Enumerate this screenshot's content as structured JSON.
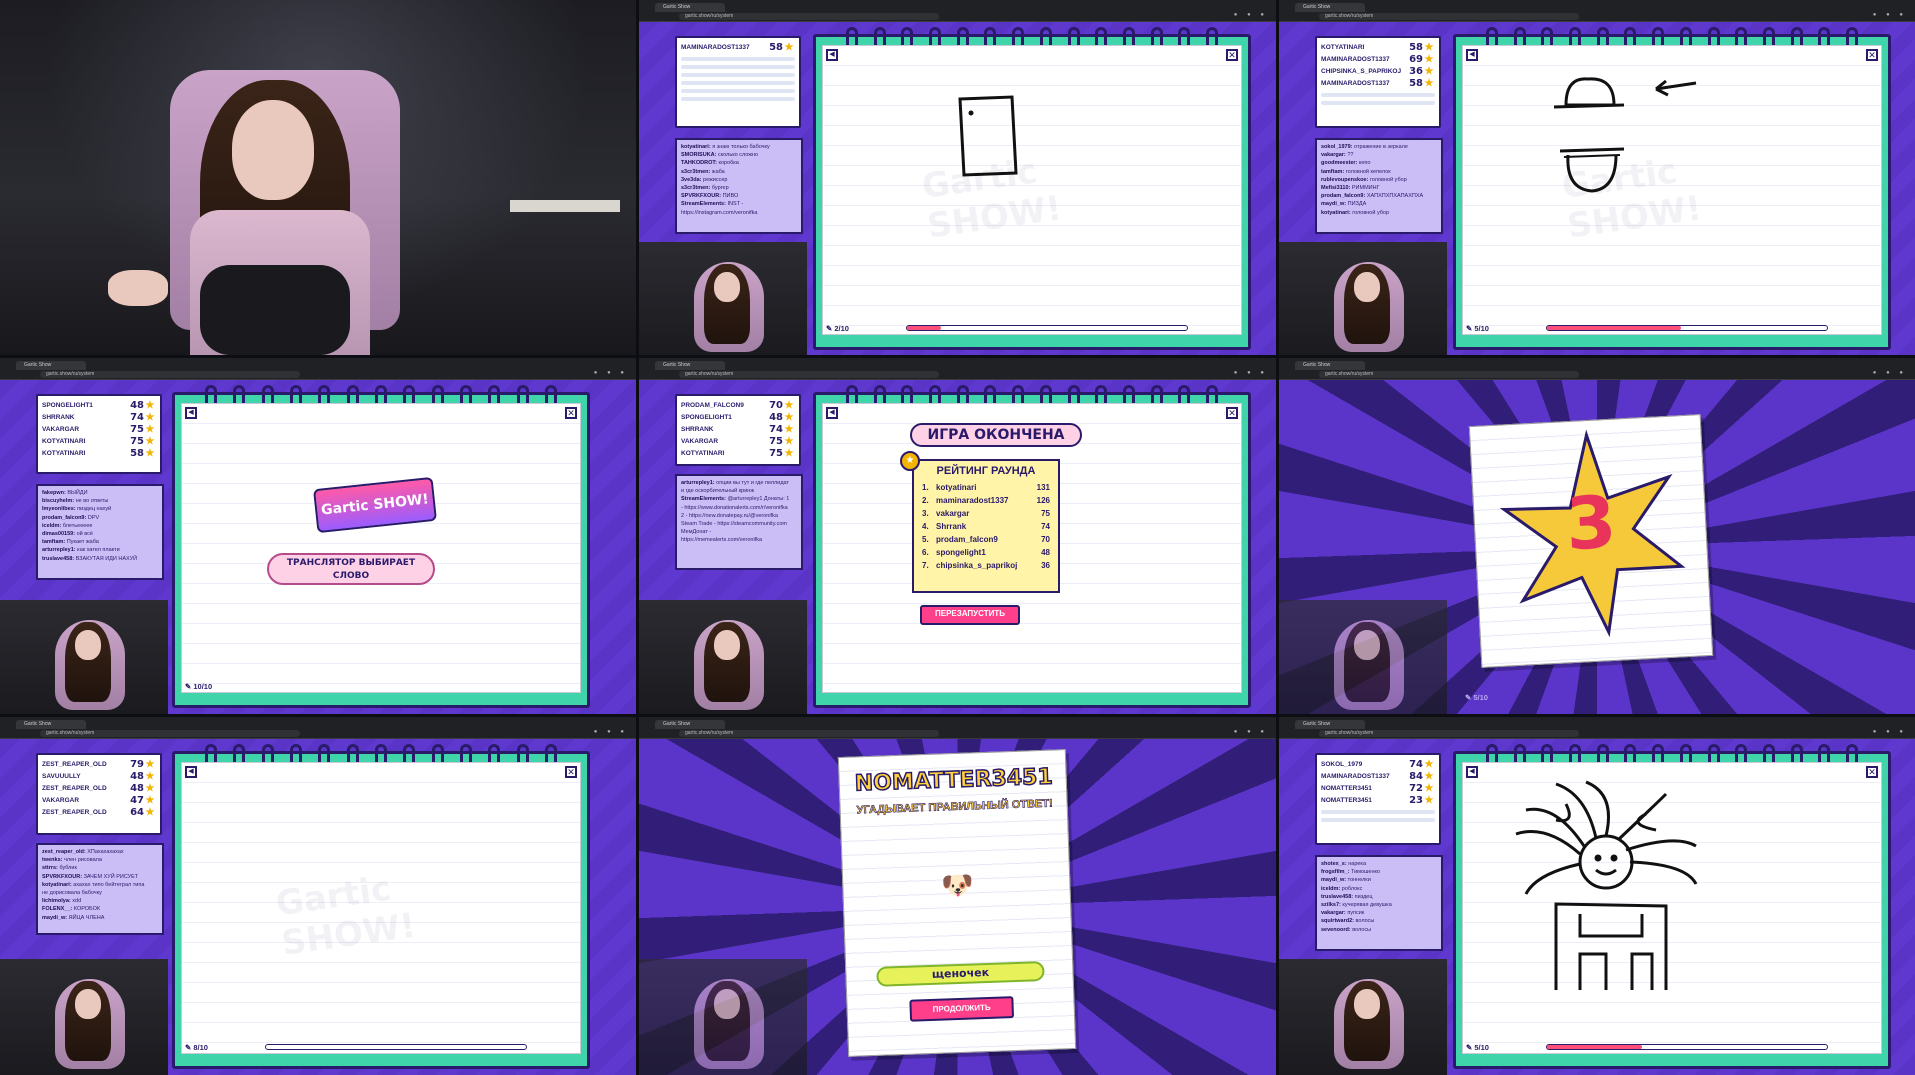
{
  "browser": {
    "tab_title": "Gartic Show",
    "url": "gartic.show/ru/system"
  },
  "icons": {
    "close": "close-icon",
    "volume": "volume-icon",
    "star": "star-icon",
    "pencil": "pencil-icon",
    "timer": "timer-icon"
  },
  "colors": {
    "game_bg": "#5b35c9",
    "board": "#3fd4a9",
    "ink": "#2a1a6a",
    "accent_pink": "#ff3f8a",
    "star": "#f2b400"
  },
  "tiles": {
    "t2": {
      "scores": [
        {
          "name": "MAMINARADOST1337",
          "points": "58"
        }
      ],
      "chat": [
        {
          "user": "kotyatinari:",
          "msg": "я знаю только бабочку"
        },
        {
          "user": "SMORISUKA:",
          "msg": "сколько сложно"
        },
        {
          "user": "TAHKODROT:",
          "msg": "коробка"
        },
        {
          "user": "s3cr3tmen:",
          "msg": "жаба"
        },
        {
          "user": "3ve3da:",
          "msg": "режиссер"
        },
        {
          "user": "s3cr3tmen:",
          "msg": "бургер"
        },
        {
          "user": "SPVRKFXOUR:",
          "msg": "ПИВО"
        },
        {
          "user": "StreamElements:",
          "msg": "INST -"
        },
        {
          "user": "",
          "msg": "https://instagram.com/veronifka"
        }
      ],
      "round": "2/10"
    },
    "t3": {
      "scores": [
        {
          "name": "KOTYATINARI",
          "points": "58"
        },
        {
          "name": "MAMINARADOST1337",
          "points": "69"
        },
        {
          "name": "CHIPSINKA_S_PAPRIKOJ",
          "points": "36"
        },
        {
          "name": "MAMINARADOST1337",
          "points": "58"
        }
      ],
      "chat": [
        {
          "user": "sokol_1979:",
          "msg": "отражение в зеркале"
        },
        {
          "user": "vakargar:",
          "msg": "??"
        },
        {
          "user": "goodmeester:",
          "msg": "кепо"
        },
        {
          "user": "tamftam:",
          "msg": "головной кепелок"
        },
        {
          "user": "rublevoupenskoe:",
          "msg": "головной убор"
        },
        {
          "user": "Mefisi3110:",
          "msg": "РИММИНГ"
        },
        {
          "user": "prodam_falcon9:",
          "msg": "ХАПХПХПХАПАХПХА"
        },
        {
          "user": "maydi_w:",
          "msg": "ПИЗДА"
        },
        {
          "user": "kotyatinari:",
          "msg": "головной убор"
        }
      ],
      "round": "5/10"
    },
    "t4": {
      "scores": [
        {
          "name": "SPONGELIGHT1",
          "points": "48"
        },
        {
          "name": "SHRRANK",
          "points": "74"
        },
        {
          "name": "VAKARGAR",
          "points": "75"
        },
        {
          "name": "KOTYATINARI",
          "points": "75"
        },
        {
          "name": "KOTYATINARI",
          "points": "58"
        }
      ],
      "chat": [
        {
          "user": "fakepwn:",
          "msg": "ВЫЙДИ"
        },
        {
          "user": "biscuyhelm:",
          "msg": "не во ответы"
        },
        {
          "user": "Imyeonlibes:",
          "msg": "пиздец нахуй"
        },
        {
          "user": "prodam_falcon9:",
          "msg": "DPV"
        },
        {
          "user": "iceldm:",
          "msg": "блетьеееее"
        },
        {
          "user": "dimas00159:",
          "msg": "ой всё"
        },
        {
          "user": "tamftam:",
          "msg": "Пукает жаба"
        },
        {
          "user": "arturrepley1:",
          "msg": "как хател плакти"
        },
        {
          "user": "truslave458:",
          "msg": "ВЗАКУТАЯ ИДИ НАХУЙ"
        }
      ],
      "logo": "Gartic SHOW!",
      "status": "ТРАНСЛЯТОР ВЫБИРАЕТ СЛОВО",
      "round": "10/10"
    },
    "t5": {
      "scores": [
        {
          "name": "PRODAM_FALCON9",
          "points": "70"
        },
        {
          "name": "SPONGELIGHT1",
          "points": "48"
        },
        {
          "name": "SHRRANK",
          "points": "74"
        },
        {
          "name": "VAKARGAR",
          "points": "75"
        },
        {
          "name": "KOTYATINARI",
          "points": "75"
        }
      ],
      "chat": [
        {
          "user": "arturrepley1:",
          "msg": "опции вы тут и где пеллидат"
        },
        {
          "user": "",
          "msg": "и где оскорбительный кринж"
        },
        {
          "user": "StreamElements:",
          "msg": "@arturrepley1 Донаты: 1"
        },
        {
          "user": "",
          "msg": "- https://www.donationalerts.com/r/veronifka"
        },
        {
          "user": "",
          "msg": "2 - https://new.donatepay.ru/@veronifka"
        },
        {
          "user": "",
          "msg": "Steam Trade - https://steamcommunity.com"
        },
        {
          "user": "",
          "msg": "МемДонат -"
        },
        {
          "user": "",
          "msg": "https://memealerts.com/veronifka"
        }
      ],
      "game_over": "ИГРА ОКОНЧЕНА",
      "ranking_title": "РЕЙТИНГ РАУНДА",
      "ranking": [
        {
          "pos": "1.",
          "name": "kotyatinari",
          "points": "131"
        },
        {
          "pos": "2.",
          "name": "maminaradost1337",
          "points": "126"
        },
        {
          "pos": "3.",
          "name": "vakargar",
          "points": "75"
        },
        {
          "pos": "4.",
          "name": "Shrrank",
          "points": "74"
        },
        {
          "pos": "5.",
          "name": "prodam_falcon9",
          "points": "70"
        },
        {
          "pos": "6.",
          "name": "spongelight1",
          "points": "48"
        },
        {
          "pos": "7.",
          "name": "chipsinka_s_paprikoj",
          "points": "36"
        }
      ],
      "restart": "ПЕРЕЗАПУСТИТЬ"
    },
    "t6": {
      "countdown": "3",
      "round": "5/10"
    },
    "t7": {
      "scores": [
        {
          "name": "ZEST_REAPER_OLD",
          "points": "79"
        },
        {
          "name": "SAVUUULLY",
          "points": "48"
        },
        {
          "name": "ZEST_REAPER_OLD",
          "points": "48"
        },
        {
          "name": "VAKARGAR",
          "points": "47"
        },
        {
          "name": "ZEST_REAPER_OLD",
          "points": "64"
        }
      ],
      "chat": [
        {
          "user": "zest_reaper_old:",
          "msg": "ХПахахахахах"
        },
        {
          "user": "twenks:",
          "msg": "член рисовала"
        },
        {
          "user": "sttrrs:",
          "msg": "бублик"
        },
        {
          "user": "SPVRKFXOUR:",
          "msg": "ЗАЧЕМ ХУЙ РИСУЕТ"
        },
        {
          "user": "kotyatinari:",
          "msg": "ахахах типо бейтеграл типа"
        },
        {
          "user": "",
          "msg": "не дорисовала бабочку"
        },
        {
          "user": "lichimolya:",
          "msg": "xdd"
        },
        {
          "user": "FOLENX__:",
          "msg": "КОРОБОК"
        },
        {
          "user": "maydi_w:",
          "msg": "ЯЙЦА ЧЛЕНА"
        }
      ],
      "round": "8/10"
    },
    "t8": {
      "winner": "NOMATTER3451",
      "subtitle": "УГАДЫВАЕТ ПРАВИЛЬНЫЙ ОТВЕТ!",
      "answer": "щеночек",
      "continue": "ПРОДОЛЖИТЬ"
    },
    "t9": {
      "scores": [
        {
          "name": "SOKOL_1979",
          "points": "74"
        },
        {
          "name": "MAMINARADOST1337",
          "points": "84"
        },
        {
          "name": "NOMATTER3451",
          "points": "72"
        },
        {
          "name": "NOMATTER3451",
          "points": "23"
        }
      ],
      "chat": [
        {
          "user": "shotex_s:",
          "msg": "нарека"
        },
        {
          "user": "frogsfilm_:",
          "msg": "Тимошенко"
        },
        {
          "user": "maydi_w:",
          "msg": "тоннелки"
        },
        {
          "user": "iceldm:",
          "msg": "роблокс"
        },
        {
          "user": "truslave458:",
          "msg": "пиздец"
        },
        {
          "user": "szilks7:",
          "msg": "кучерявая девушка"
        },
        {
          "user": "vakargar:",
          "msg": "пупсик"
        },
        {
          "user": "squirtward2:",
          "msg": "волосы"
        },
        {
          "user": "sevenoord:",
          "msg": "волосы"
        }
      ],
      "round": "5/10"
    }
  }
}
